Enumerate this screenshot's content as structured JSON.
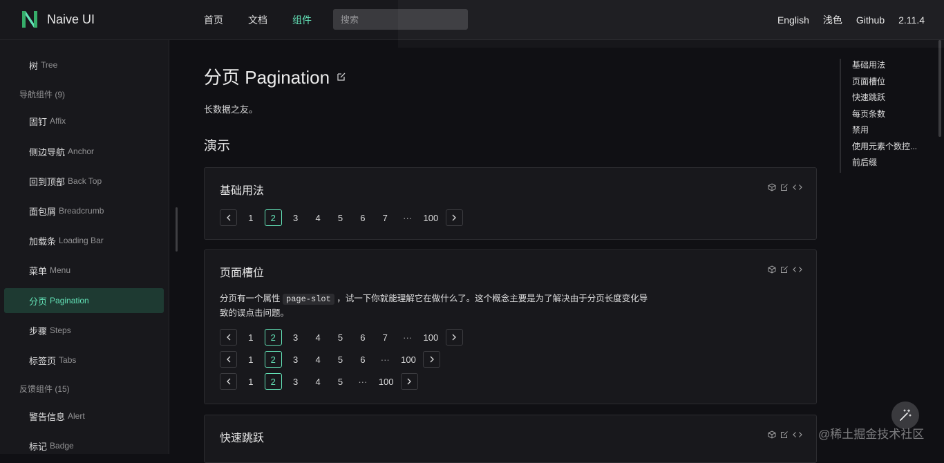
{
  "header": {
    "logo_text": "Naive UI",
    "nav": [
      "首页",
      "文档",
      "组件"
    ],
    "search_placeholder": "搜索",
    "right": [
      "English",
      "浅色",
      "Github",
      "2.11.4"
    ]
  },
  "sidebar": {
    "items": [
      {
        "zh": "树",
        "en": "Tree"
      },
      {
        "group": "导航组件 (9)"
      },
      {
        "zh": "固钉",
        "en": "Affix"
      },
      {
        "zh": "侧边导航",
        "en": "Anchor"
      },
      {
        "zh": "回到顶部",
        "en": "Back Top"
      },
      {
        "zh": "面包屑",
        "en": "Breadcrumb"
      },
      {
        "zh": "加载条",
        "en": "Loading Bar"
      },
      {
        "zh": "菜单",
        "en": "Menu"
      },
      {
        "zh": "分页",
        "en": "Pagination",
        "active": true
      },
      {
        "zh": "步骤",
        "en": "Steps"
      },
      {
        "zh": "标签页",
        "en": "Tabs"
      },
      {
        "group": "反馈组件 (15)"
      },
      {
        "zh": "警告信息",
        "en": "Alert"
      },
      {
        "zh": "标记",
        "en": "Badge"
      }
    ]
  },
  "main": {
    "title": "分页 Pagination",
    "description": "长数据之友。",
    "section": "演示",
    "cards": [
      {
        "title": "基础用法",
        "pagers": [
          [
            "1",
            "2",
            "3",
            "4",
            "5",
            "6",
            "7",
            "···",
            "100"
          ]
        ],
        "active": "2"
      },
      {
        "title": "页面槽位",
        "text_before": "分页有一个属性",
        "code": "page-slot",
        "text_after": "，试一下你就能理解它在做什么了。这个概念主要是为了解决由于分页长度变化导致的误点击问题。",
        "pagers": [
          [
            "1",
            "2",
            "3",
            "4",
            "5",
            "6",
            "7",
            "···",
            "100"
          ],
          [
            "1",
            "2",
            "3",
            "4",
            "5",
            "6",
            "···",
            "100"
          ],
          [
            "1",
            "2",
            "3",
            "4",
            "5",
            "···",
            "100"
          ]
        ],
        "active": "2"
      },
      {
        "title": "快速跳跃"
      }
    ]
  },
  "toc": [
    "基础用法",
    "页面槽位",
    "快速跳跃",
    "每页条数",
    "禁用",
    "使用元素个数控...",
    "前后缀"
  ],
  "watermark": "@稀土掘金技术社区",
  "colors": {
    "accent": "#63e2b7",
    "bg": "#101014",
    "panel": "#18181c"
  }
}
